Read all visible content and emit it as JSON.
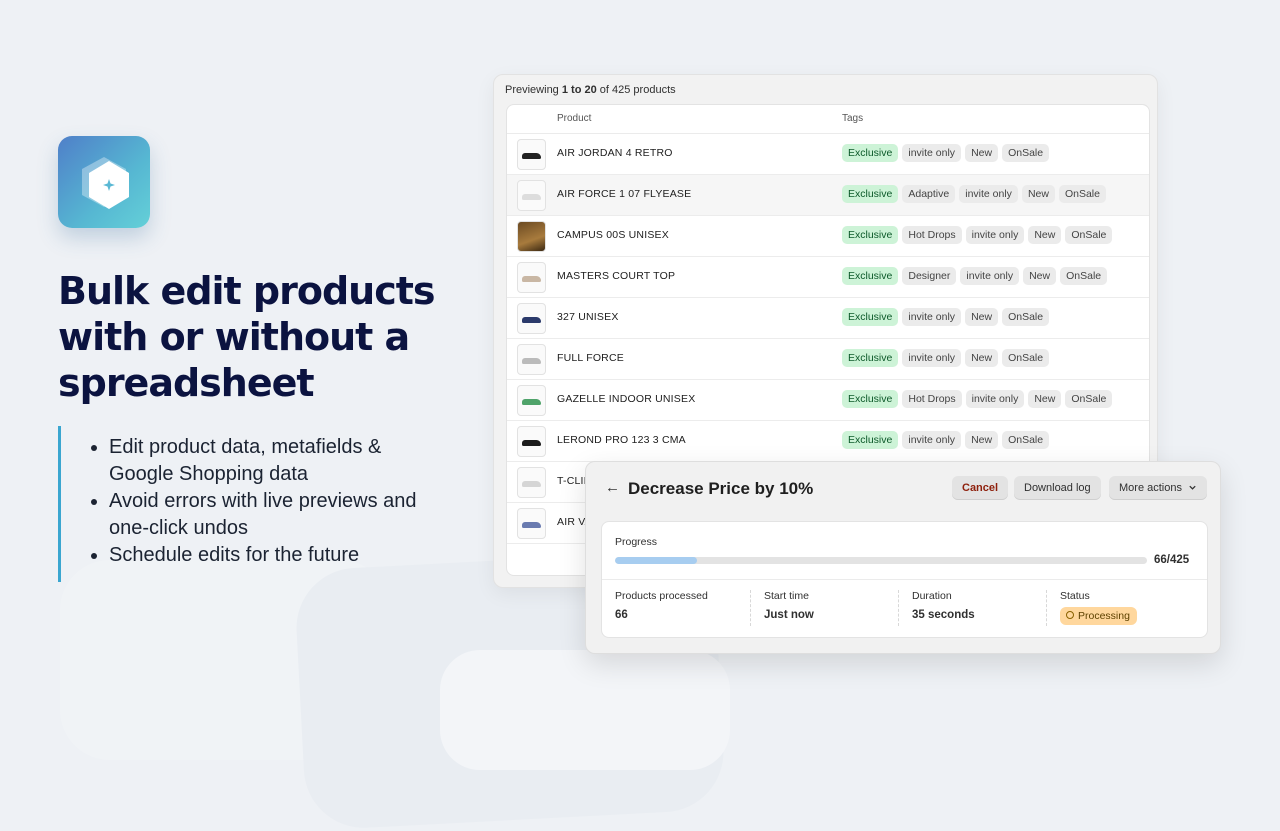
{
  "hero": {
    "headline": "Bulk edit products with or without a spreadsheet",
    "features": [
      "Edit product data, metafields & Google Shopping data",
      "Avoid errors with live previews and one-click undos",
      "Schedule edits for the future"
    ]
  },
  "preview": {
    "prefix": "Previewing",
    "range": "1 to 20",
    "suffix": "of 425 products"
  },
  "table": {
    "columns": [
      "Product",
      "Tags"
    ],
    "rows": [
      {
        "name": "AIR JORDAN 4 RETRO",
        "tags": [
          "Exclusive",
          "invite only",
          "New",
          "OnSale"
        ]
      },
      {
        "name": "AIR FORCE 1 07 FLYEASE",
        "tags": [
          "Exclusive",
          "Adaptive",
          "invite only",
          "New",
          "OnSale"
        ]
      },
      {
        "name": "CAMPUS 00S UNISEX",
        "tags": [
          "Exclusive",
          "Hot Drops",
          "invite only",
          "New",
          "OnSale"
        ]
      },
      {
        "name": "MASTERS COURT TOP",
        "tags": [
          "Exclusive",
          "Designer",
          "invite only",
          "New",
          "OnSale"
        ]
      },
      {
        "name": "327 UNISEX",
        "tags": [
          "Exclusive",
          "invite only",
          "New",
          "OnSale"
        ]
      },
      {
        "name": "FULL FORCE",
        "tags": [
          "Exclusive",
          "invite only",
          "New",
          "OnSale"
        ]
      },
      {
        "name": "GAZELLE INDOOR UNISEX",
        "tags": [
          "Exclusive",
          "Hot Drops",
          "invite only",
          "New",
          "OnSale"
        ]
      },
      {
        "name": "LEROND PRO 123 3 CMA",
        "tags": [
          "Exclusive",
          "invite only",
          "New",
          "OnSale"
        ]
      },
      {
        "name": "T-CLII",
        "tags": []
      },
      {
        "name": "AIR VA",
        "tags": []
      }
    ]
  },
  "job": {
    "title": "Decrease Price by 10%",
    "cancel_label": "Cancel",
    "download_label": "Download log",
    "more_label": "More actions",
    "progress_label": "Progress",
    "progress_value": 0.155,
    "progress_count": "66/425",
    "stats": {
      "processed_label": "Products processed",
      "processed_value": "66",
      "start_label": "Start time",
      "start_value": "Just now",
      "duration_label": "Duration",
      "duration_value": "35 seconds",
      "status_label": "Status",
      "status_value": "Processing"
    }
  },
  "colors": {
    "headline": "#0b1340",
    "accent_bar": "#3aa6d0",
    "tag_exclusive": "#cdf3d7",
    "progress_fill": "#a7cdf0",
    "status_badge": "#ffd79d",
    "cancel_text": "#8e1f0b"
  },
  "icons": {
    "logo": "hexagon-sparkle-icon",
    "back": "arrow-left-icon",
    "more_actions": "chevron-down-icon",
    "status": "processing-icon"
  }
}
